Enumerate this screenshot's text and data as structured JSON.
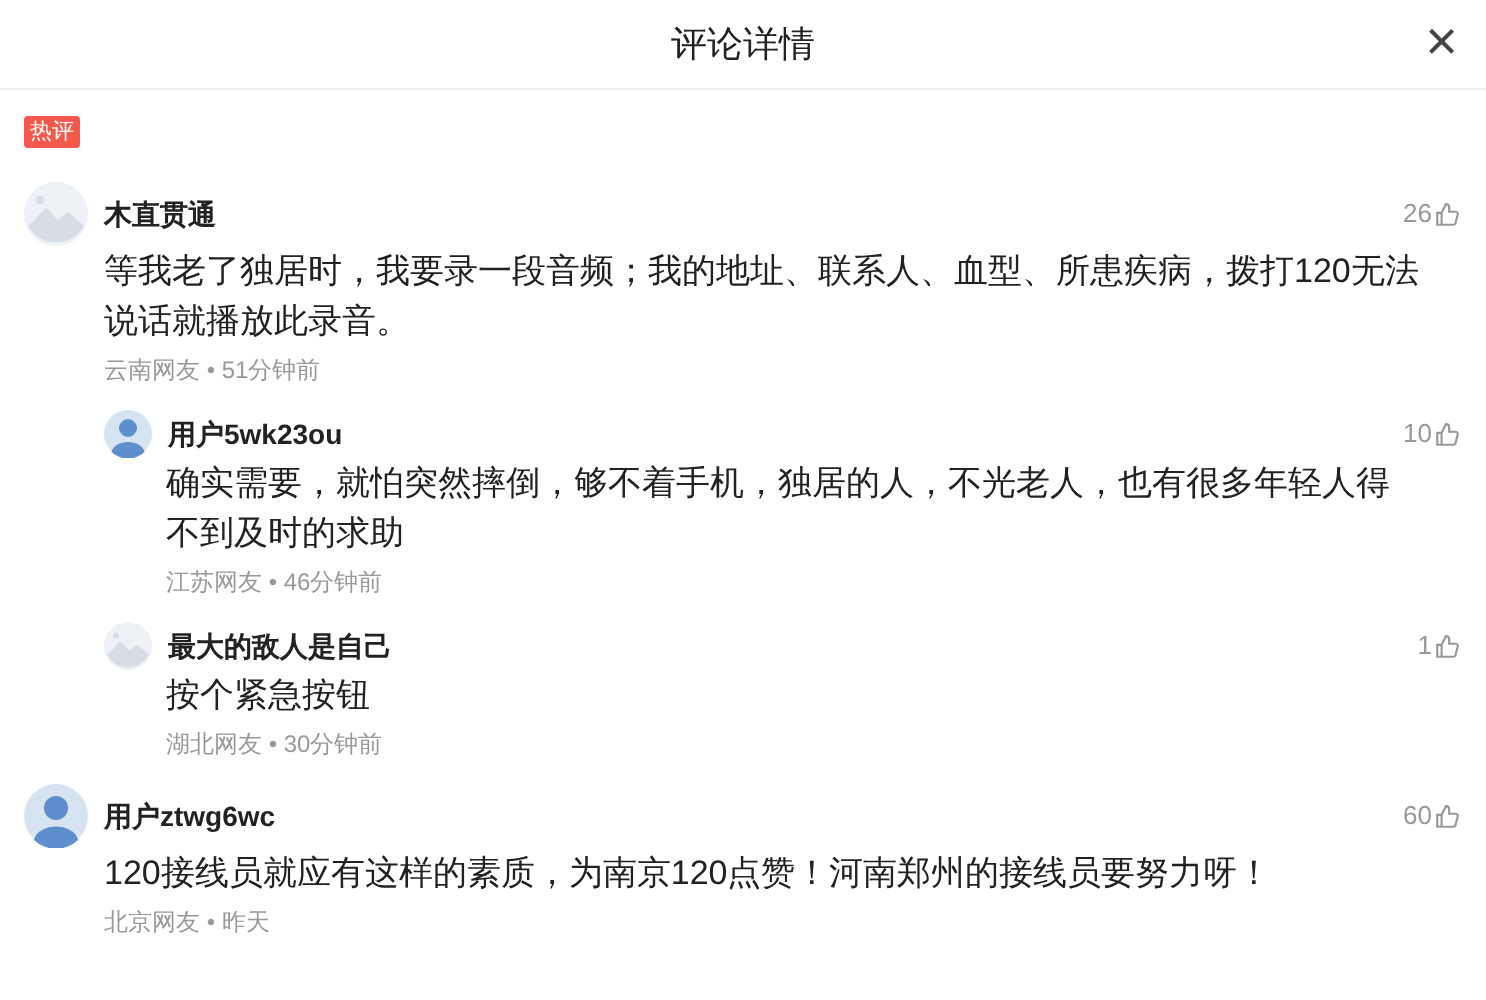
{
  "header": {
    "title": "评论详情",
    "close": "×"
  },
  "badge": "热评",
  "comments": [
    {
      "avatar": {
        "kind": "landscape"
      },
      "name": "木直贯通",
      "likes": "26",
      "text": "等我老了独居时，我要录一段音频；我的地址、联系人、血型、所患疾病，拨打120无法说话就播放此录音。",
      "meta": "云南网友 • 51分钟前",
      "children": [
        {
          "avatar": {
            "kind": "person"
          },
          "name": "用户5wk23ou",
          "likes": "10",
          "text": "确实需要，就怕突然摔倒，够不着手机，独居的人，不光老人，也有很多年轻人得不到及时的求助",
          "meta": "江苏网友 • 46分钟前"
        },
        {
          "avatar": {
            "kind": "landscape"
          },
          "name": "最大的敌人是自己",
          "likes": "1",
          "text": "按个紧急按钮",
          "meta": "湖北网友 • 30分钟前"
        }
      ]
    },
    {
      "avatar": {
        "kind": "person"
      },
      "name": "用户ztwg6wc",
      "likes": "60",
      "text": "120接线员就应有这样的素质，为南京120点赞！河南郑州的接线员要努力呀！",
      "meta": "北京网友 • 昨天"
    }
  ]
}
